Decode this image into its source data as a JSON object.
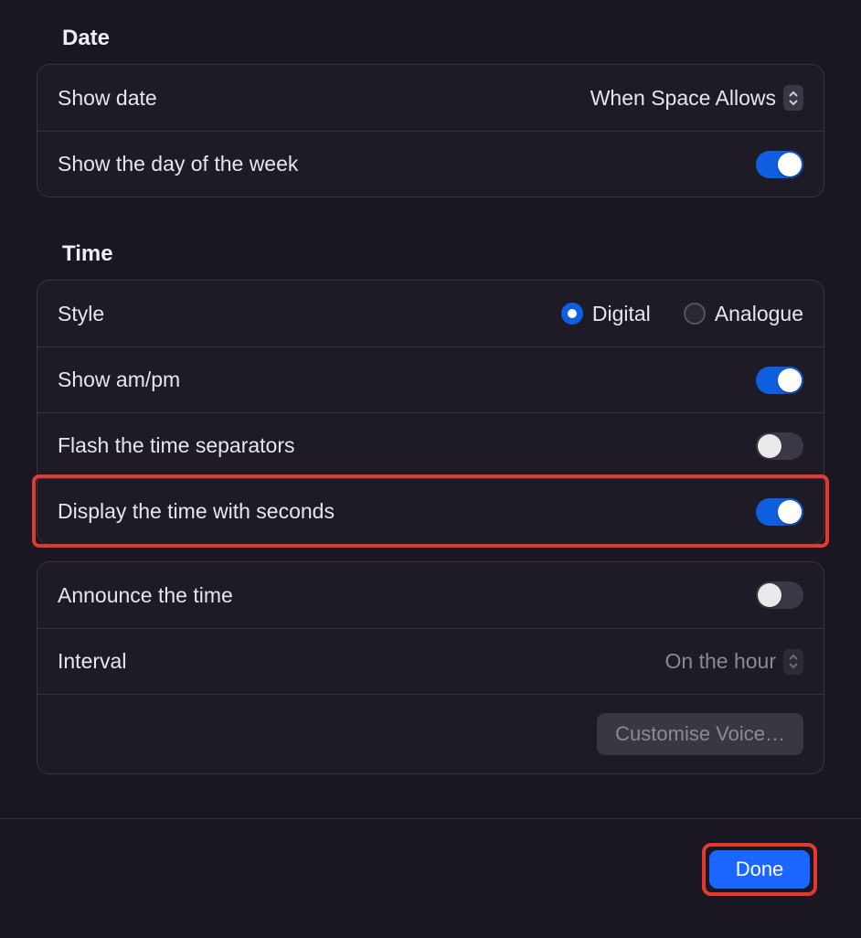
{
  "date": {
    "title": "Date",
    "show_date_label": "Show date",
    "show_date_value": "When Space Allows",
    "show_day_label": "Show the day of the week",
    "show_day_on": true
  },
  "time": {
    "title": "Time",
    "style_label": "Style",
    "style_options": {
      "digital": "Digital",
      "analogue": "Analogue"
    },
    "style_selected": "digital",
    "show_ampm_label": "Show am/pm",
    "show_ampm_on": true,
    "flash_sep_label": "Flash the time separators",
    "flash_sep_on": false,
    "show_seconds_label": "Display the time with seconds",
    "show_seconds_on": true,
    "announce_label": "Announce the time",
    "announce_on": false,
    "interval_label": "Interval",
    "interval_value": "On the hour",
    "customise_voice_label": "Customise Voice…"
  },
  "footer": {
    "done_label": "Done"
  }
}
